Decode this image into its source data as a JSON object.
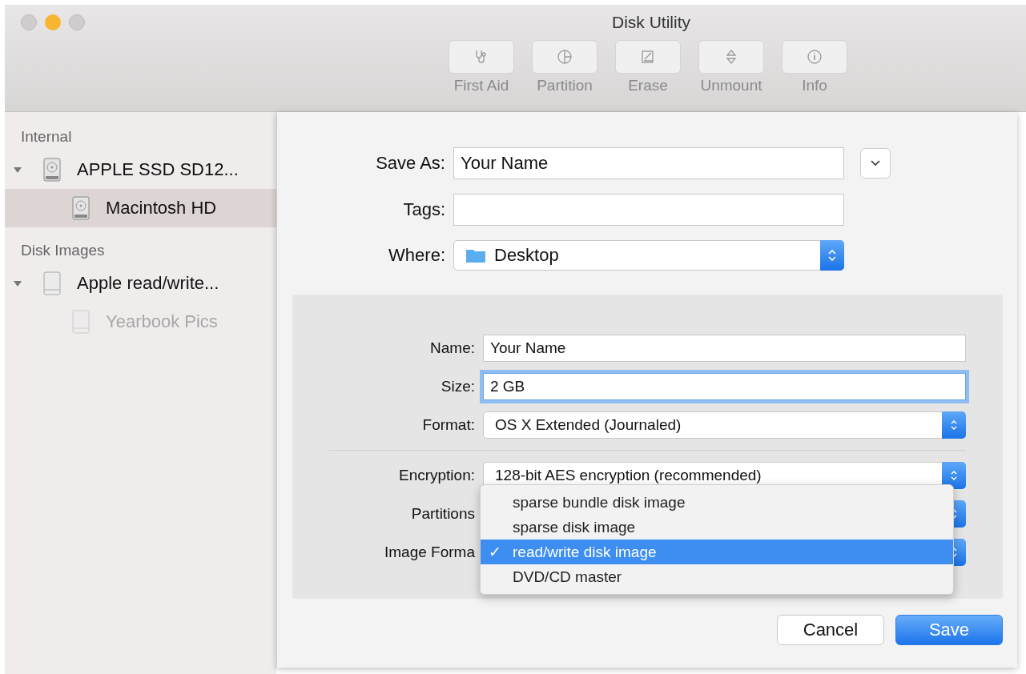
{
  "window": {
    "title": "Disk Utility"
  },
  "toolbar": [
    {
      "label": "First Aid",
      "kind": "stethoscope",
      "disabled": true
    },
    {
      "label": "Partition",
      "kind": "pie",
      "disabled": true
    },
    {
      "label": "Erase",
      "kind": "erase",
      "disabled": true
    },
    {
      "label": "Unmount",
      "kind": "unmount",
      "disabled": true
    },
    {
      "label": "Info",
      "kind": "info",
      "disabled": true
    }
  ],
  "sidebar": {
    "sections": [
      {
        "title": "Internal",
        "items": [
          {
            "label": "APPLE SSD SD12...",
            "kind": "internal",
            "expanded": true,
            "selected": false,
            "disabled": false,
            "children": [
              {
                "label": "Macintosh HD",
                "kind": "internal",
                "selected": true,
                "disabled": false
              }
            ]
          }
        ]
      },
      {
        "title": "Disk Images",
        "items": [
          {
            "label": "Apple read/write...",
            "kind": "image",
            "expanded": true,
            "selected": false,
            "disabled": false,
            "children": [
              {
                "label": "Yearbook Pics",
                "kind": "image",
                "selected": false,
                "disabled": true
              }
            ]
          }
        ]
      }
    ]
  },
  "save_dialog": {
    "save_as": {
      "label": "Save As:",
      "value": "Your Name"
    },
    "tags": {
      "label": "Tags:"
    },
    "where": {
      "label": "Where:",
      "value": "Desktop"
    },
    "options": [
      {
        "kind": "text",
        "label": "Name:",
        "value": "Your Name",
        "focused": false
      },
      {
        "kind": "text",
        "label": "Size:",
        "value": "2 GB",
        "focused": true
      },
      {
        "kind": "popup",
        "label": "Format:",
        "value": "OS X Extended (Journaled)"
      },
      {
        "kind": "divider"
      },
      {
        "kind": "popup",
        "label": "Encryption:",
        "value": "128-bit AES encryption (recommended)"
      },
      {
        "kind": "popup",
        "label": "Partitions"
      },
      {
        "kind": "popup",
        "label": "Image Forma"
      }
    ],
    "popup_menu": [
      {
        "label": "sparse bundle disk image",
        "selected": false
      },
      {
        "label": "sparse disk image",
        "selected": false
      },
      {
        "label": "read/write disk image",
        "selected": true
      },
      {
        "label": "DVD/CD master",
        "selected": false
      }
    ],
    "check_mark": "✓",
    "buttons": [
      {
        "label": "Cancel",
        "default": false
      },
      {
        "label": "Save",
        "default": true
      }
    ]
  }
}
